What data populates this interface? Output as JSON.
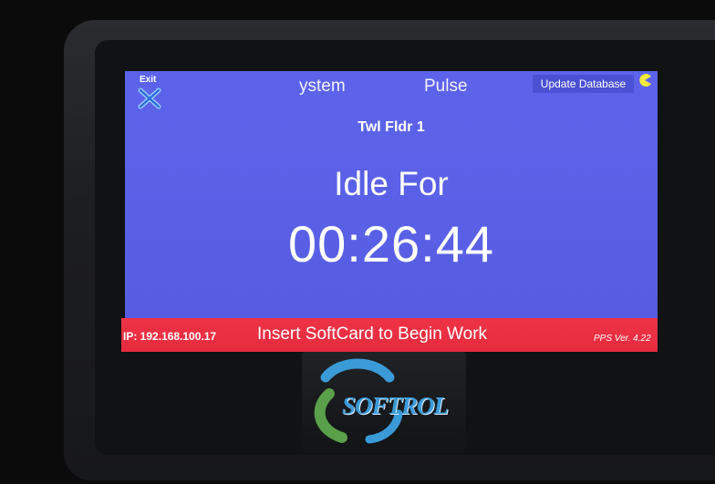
{
  "screen": {
    "exit_label": "Exit",
    "tabs": [
      {
        "label": "ystem"
      },
      {
        "label": "Pulse"
      }
    ],
    "update_button_label": "Update Database",
    "machine_name": "Twl Fldr 1",
    "idle_label": "Idle For",
    "idle_timer": "00:26:44"
  },
  "status_bar": {
    "ip": "IP: 192.168.100.17",
    "prompt": "Insert SoftCard to Begin Work",
    "version": "PPS Ver. 4.22"
  },
  "logo": {
    "text": "SOFTROL"
  },
  "icons": {
    "exit": "close-x-icon",
    "connection": "pacman-status-icon",
    "logo": "softrol-swirl-logo"
  },
  "colors": {
    "screen_bg": "#5a60e6",
    "status_bar_bg": "#e62b3f",
    "update_button_bg": "#4a51d4",
    "logo_blue": "#3a9bd8",
    "logo_green": "#5aa04a",
    "pacman_yellow": "#f2ea3a"
  }
}
